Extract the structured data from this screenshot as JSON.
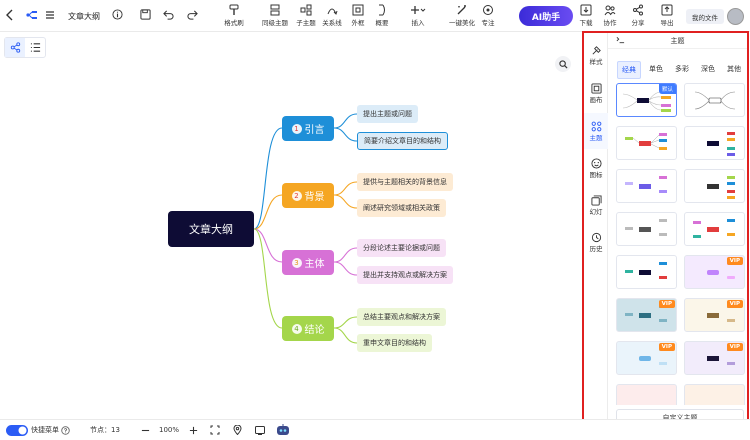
{
  "header": {
    "doc_title": "文章大纲",
    "tools": [
      {
        "label": "格式刷"
      },
      {
        "label": "同级主题"
      },
      {
        "label": "子主题"
      },
      {
        "label": "关系线"
      },
      {
        "label": "外框"
      },
      {
        "label": "概要"
      },
      {
        "label": "插入"
      },
      {
        "label": "一键美化"
      },
      {
        "label": "专注"
      }
    ],
    "ai_label": "AI助手",
    "right_tools": [
      {
        "label": "下载"
      },
      {
        "label": "协作"
      },
      {
        "label": "分享"
      },
      {
        "label": "导出"
      }
    ],
    "my_files": "我的文件"
  },
  "mindmap": {
    "root": "文章大纲",
    "topics": [
      {
        "num": "1",
        "label": "引言",
        "color": "#1e8fd8",
        "subs": [
          "提出主题或问题",
          "简要介绍文章目的和结构"
        ],
        "sub_bg": "#dcecf8",
        "line": "#1e8fd8"
      },
      {
        "num": "2",
        "label": "背景",
        "color": "#f5a623",
        "subs": [
          "提供与主题相关的背景信息",
          "阐述研究领域或相关政策"
        ],
        "sub_bg": "#fdebd4",
        "line": "#f5a623"
      },
      {
        "num": "3",
        "label": "主体",
        "color": "#d771d6",
        "subs": [
          "分段论述主要论据或问题",
          "提出并支持观点或解决方案"
        ],
        "sub_bg": "#f7e2f6",
        "line": "#d771d6"
      },
      {
        "num": "4",
        "label": "结论",
        "color": "#a4d64b",
        "subs": [
          "总结主要观点和解决方案",
          "重申文章目的和结构"
        ],
        "sub_bg": "#ecf6d6",
        "line": "#a4d64b"
      }
    ]
  },
  "bottom": {
    "quick_menu": "快捷菜单",
    "nodes": "节点：13",
    "zoom": "100%"
  },
  "panel": {
    "title": "主题",
    "tabs": [
      {
        "label": "样式",
        "icon": "brush-icon"
      },
      {
        "label": "画布",
        "icon": "canvas-icon"
      },
      {
        "label": "主题",
        "icon": "theme-icon"
      },
      {
        "label": "图标",
        "icon": "smile-icon"
      },
      {
        "label": "幻灯",
        "icon": "slides-icon"
      },
      {
        "label": "历史",
        "icon": "history-icon"
      }
    ],
    "active_tab": "主题",
    "categories": [
      "经典",
      "单色",
      "多彩",
      "深色",
      "其他"
    ],
    "active_category": "经典",
    "default_tag": "默认",
    "vip_tag": "VIP",
    "custom_button": "自定义主题"
  },
  "colors": {
    "accent": "#2b5cf5",
    "panel_border": "#e02020",
    "root_bg": "#0e0c35"
  }
}
